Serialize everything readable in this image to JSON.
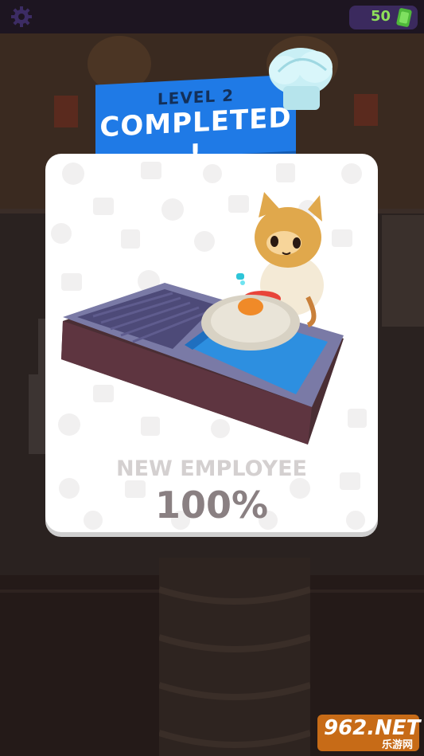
{
  "hud": {
    "currency_value": "50",
    "settings_icon": "gear-icon",
    "currency_icon": "cash-icon"
  },
  "banner": {
    "level": "LEVEL 2",
    "title": "COMPLETED !"
  },
  "card": {
    "employee_label": "NEW EMPLOYEE",
    "employee_percent": "100%"
  },
  "watermark": {
    "main": "962.NET",
    "sub": "乐游网"
  },
  "colors": {
    "banner": "#1f7ae6",
    "currency_green": "#8ee05a",
    "topbar": "#1d1521"
  }
}
